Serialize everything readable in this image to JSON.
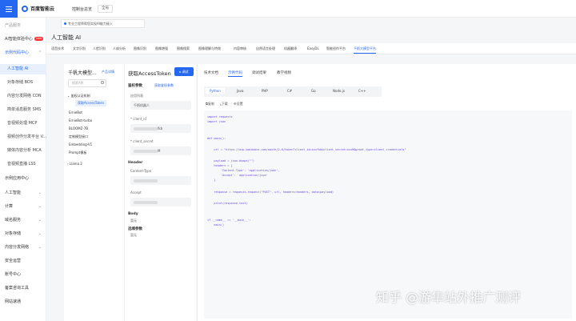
{
  "topbar": {
    "brand": "百度智能云",
    "console": "控制台总览",
    "region": "全局"
  },
  "sidebar": {
    "items": [
      {
        "label": "产品服务"
      },
      {
        "label": "AI智能体验中心",
        "badge": "new"
      },
      {
        "label": "示例代码中心"
      },
      {
        "label": "人工智能 AI"
      },
      {
        "label": "对象存储 BOS"
      },
      {
        "label": "内容分发网络 CDN"
      },
      {
        "label": "简单消息服务 SMS"
      },
      {
        "label": "音视频处理 MCP"
      },
      {
        "label": "视频创作分发平台 V..."
      },
      {
        "label": "媒体内容分析 MCA"
      },
      {
        "label": "音视频直播 LSS"
      },
      {
        "label": "示例应用中心"
      },
      {
        "label": "人工智能"
      },
      {
        "label": "计算"
      },
      {
        "label": "域名服务"
      },
      {
        "label": "对象存储"
      },
      {
        "label": "内容分发网络"
      },
      {
        "label": "安全运营"
      },
      {
        "label": "账号中心"
      },
      {
        "label": "备案咨询工具"
      },
      {
        "label": "网站速通"
      }
    ]
  },
  "notice": "专业工程师帮您实现AI能力接入",
  "page_title": "人工智能 AI",
  "tabs": [
    "语音技术",
    "文字识别",
    "人脸识别",
    "人体分析",
    "图像识别",
    "图像增强",
    "图像搜索",
    "图像理解与特效",
    "内容审核",
    "自然语言处理",
    "机器翻译",
    "EasyDL",
    "智能创作平台",
    "千帆大模型平台"
  ],
  "left_panel": {
    "title": "千帆大模型...",
    "link": "产品详情",
    "search_placeholder": "搜索API",
    "tree": [
      "鉴权认证机制",
      "获取AccessToken",
      "ErnieBot",
      "ErnieBot-turbo",
      "BLOOMZ-7B",
      "定制模型接口",
      "Embedding-V1",
      "Prompt模板",
      "Llama 2"
    ]
  },
  "mid_panel": {
    "api_title": "获取AccessToken",
    "debug_label": "调试",
    "auth_params_label": "鉴权参数",
    "auth_link": "获取鉴权参数",
    "app_list_label": "应用列表",
    "app_value": "千帆机器人",
    "client_id_label": "client_id",
    "client_id_suffix": "fkb",
    "client_secret_label": "client_secret",
    "client_secret_suffix": "M",
    "header_label": "Header",
    "content_type_label": "Content-Type",
    "accept_label": "Accept",
    "body_label": "Body",
    "body_value": "暂无",
    "optional_label": "选填参数",
    "optional_value": "暂无"
  },
  "right_panel": {
    "tabs": [
      "技术文档",
      "示例代码",
      "调试结果",
      "教学视频"
    ],
    "langs": [
      "Python",
      "Java",
      "PHP",
      "C#",
      "Go",
      "Node.js",
      "C++"
    ],
    "tools": [
      "复制",
      "下载",
      "设置"
    ],
    "code": [
      "import requests",
      "import json",
      "",
      "",
      "def main():",
      "",
      "    url = \"https://aip.baidubce.com/oauth/2.0/token?client_id=xxxfkb&client_secret=xxxM&grant_type=client_credentials\"",
      "",
      "    payload = json.dumps(\"\")",
      "    headers = {",
      "        'Content-Type': 'application/json',",
      "        'Accept': 'application/json'",
      "    }",
      "",
      "    response = requests.request(\"POST\", url, headers=headers, data=payload)",
      "",
      "    print(response.text)",
      "",
      "",
      "if __name__ == '__main__':",
      "    main()"
    ]
  },
  "watermark": "知乎 @游隼站外推广测评"
}
